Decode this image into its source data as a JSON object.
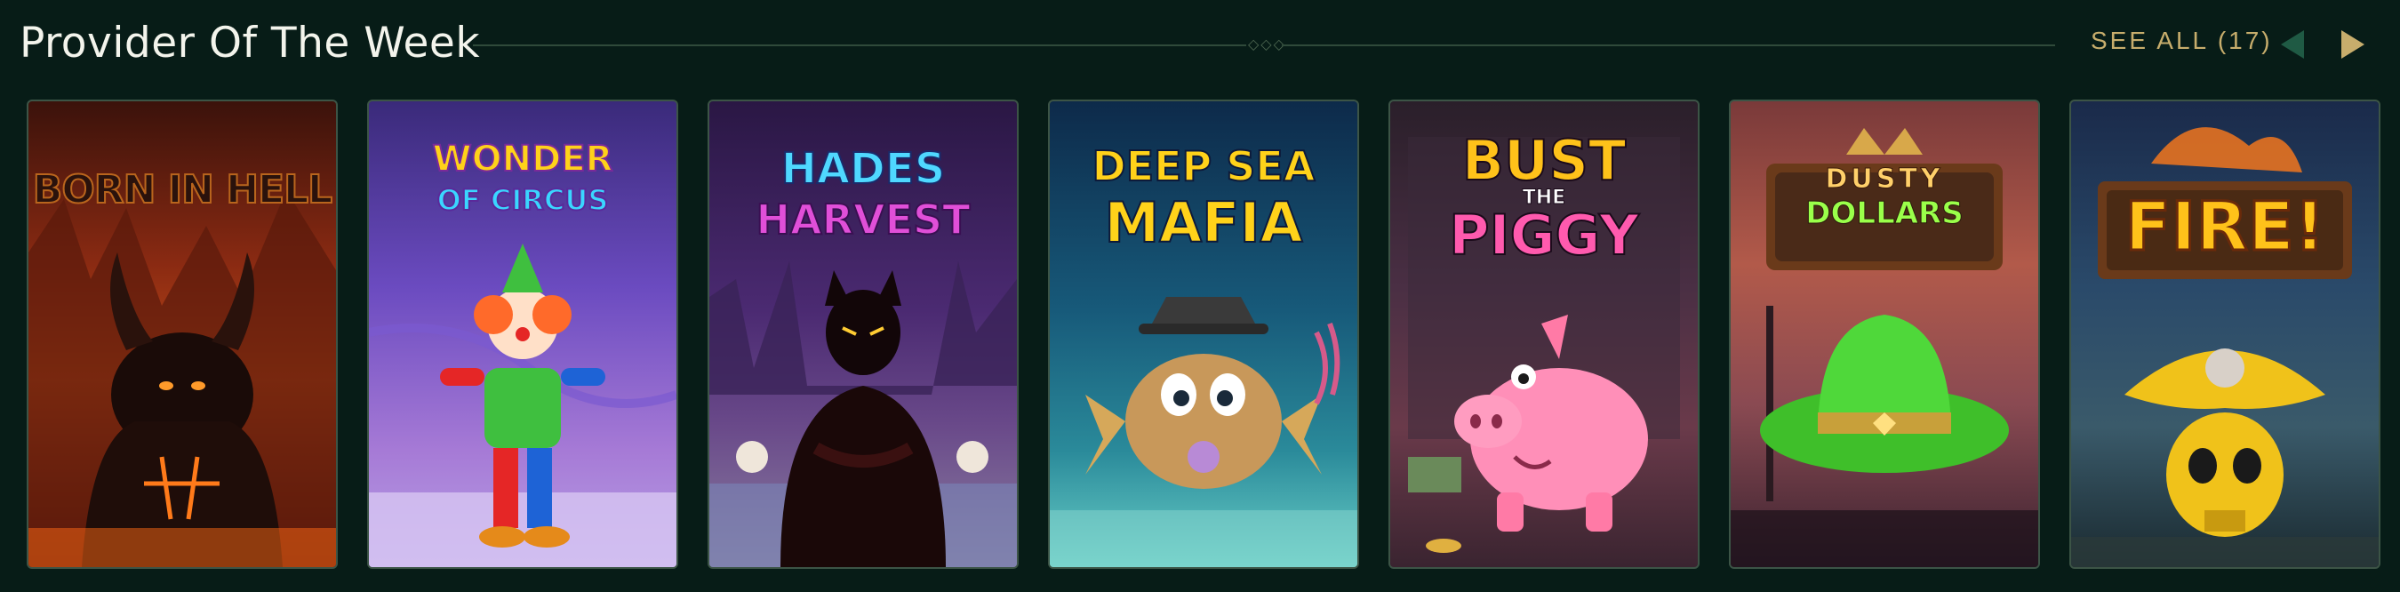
{
  "header": {
    "title": "Provider Of The Week",
    "see_all_label": "SEE ALL (17)",
    "prev_icon": "chevron-left-icon",
    "next_icon": "chevron-right-icon"
  },
  "colors": {
    "background": "#071c17",
    "accent": "#c7ad6c",
    "card_border": "#3c5446"
  },
  "games": [
    {
      "title_line1": "BORN IN HELL",
      "title_line2": ""
    },
    {
      "title_line1": "WONDER",
      "title_line2": "OF CIRCUS"
    },
    {
      "title_line1": "HADES",
      "title_line2": "HARVEST"
    },
    {
      "title_line1": "DEEP SEA",
      "title_line2": "MAFIA"
    },
    {
      "title_line1": "BUST",
      "title_line2": "THE",
      "title_line3": "PIGGY"
    },
    {
      "title_line1": "DUSTY",
      "title_line2": "DOLLARS"
    },
    {
      "title_line1": "FIRE!",
      "title_line2": ""
    }
  ]
}
